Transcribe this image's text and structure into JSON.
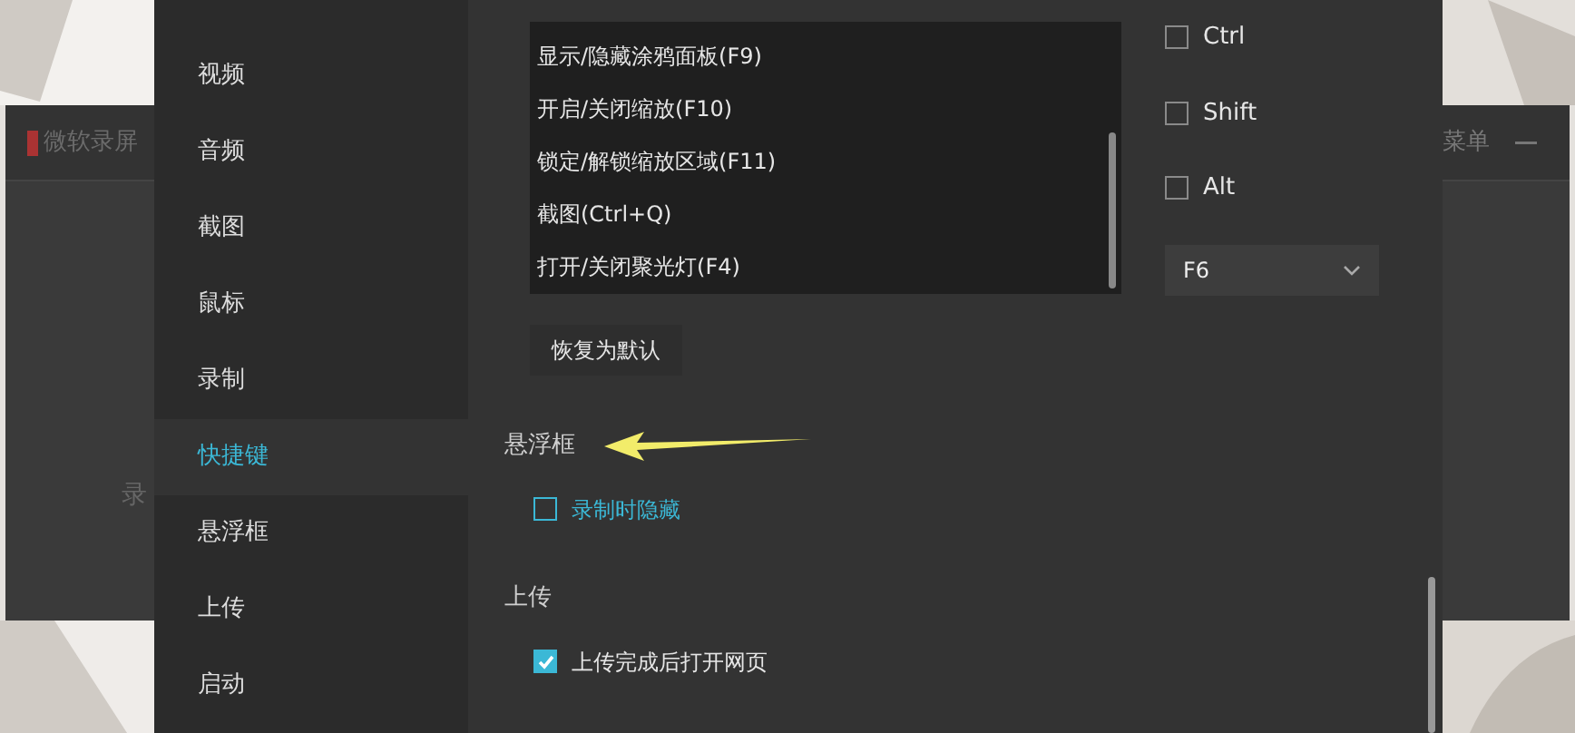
{
  "background_window": {
    "title": "微软录屏",
    "menu": "菜单",
    "fragment": "录"
  },
  "sidebar": {
    "items": [
      {
        "label": "视频",
        "selected": false
      },
      {
        "label": "音频",
        "selected": false
      },
      {
        "label": "截图",
        "selected": false
      },
      {
        "label": "鼠标",
        "selected": false
      },
      {
        "label": "录制",
        "selected": false
      },
      {
        "label": "快捷键",
        "selected": true
      },
      {
        "label": "悬浮框",
        "selected": false
      },
      {
        "label": "上传",
        "selected": false
      },
      {
        "label": "启动",
        "selected": false
      }
    ]
  },
  "shortcuts": {
    "actions": [
      "显示/隐藏涂鸦面板(F9)",
      "开启/关闭缩放(F10)",
      "锁定/解锁缩放区域(F11)",
      "截图(Ctrl+Q)",
      "打开/关闭聚光灯(F4)"
    ],
    "modifiers": [
      {
        "label": "Ctrl",
        "checked": false
      },
      {
        "label": "Shift",
        "checked": false
      },
      {
        "label": "Alt",
        "checked": false
      }
    ],
    "key": "F6",
    "reset_button": "恢复为默认"
  },
  "sections": [
    {
      "title": "悬浮框",
      "options": [
        {
          "label": "录制时隐藏",
          "checked": false,
          "hovered": true
        }
      ]
    },
    {
      "title": "上传",
      "options": [
        {
          "label": "上传完成后打开网页",
          "checked": true,
          "hovered": false
        }
      ]
    }
  ]
}
